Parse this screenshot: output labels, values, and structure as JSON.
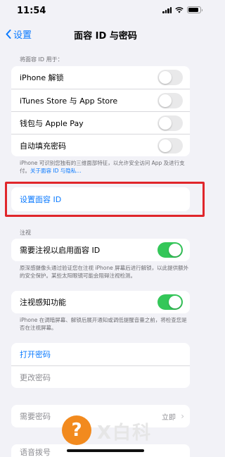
{
  "status": {
    "time": "11:54"
  },
  "nav": {
    "back_label": "设置",
    "title": "面容 ID 与密码"
  },
  "use_face_id": {
    "header": "将面容 ID 用于：",
    "items": [
      {
        "label": "iPhone 解锁",
        "on": false
      },
      {
        "label": "iTunes Store 与 App Store",
        "on": false
      },
      {
        "label": "钱包与 Apple Pay",
        "on": false
      },
      {
        "label": "自动填充密码",
        "on": false
      }
    ],
    "footer_text": "iPhone 可识别您独有的三维面部特征，以允许安全访问 App 及进行支付。",
    "footer_link": "关于面容 ID 与隐私…"
  },
  "setup": {
    "label": "设置面容 ID"
  },
  "attention": {
    "header": "注视",
    "require_label": "需要注视以启用面容 ID",
    "require_on": true,
    "require_footer": "原深感摄像头通过验证您在注视 iPhone 屏幕后进行解锁，以此提供额外的安全保护。某些太阳眼镜可能会阻碍注视检测。",
    "aware_label": "注视感知功能",
    "aware_on": true,
    "aware_footer": "iPhone 在调暗屏幕、解锁后展开通知或调低提醒音量之前，将检查您是否在注视屏幕。"
  },
  "passcode": {
    "turn_on": "打开密码",
    "change": "更改密码"
  },
  "require_passcode": {
    "label": "需要密码",
    "value": "立即"
  },
  "voice_dial": {
    "label": "语音拨号"
  },
  "watermark": {
    "text": "X白科"
  }
}
